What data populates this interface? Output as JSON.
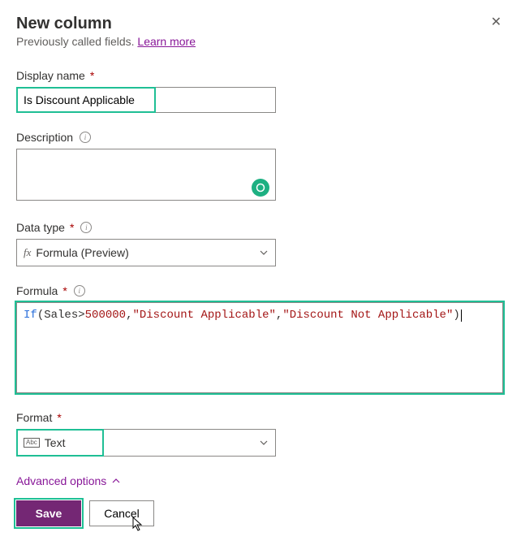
{
  "header": {
    "title": "New column",
    "subtitle_prefix": "Previously called fields. ",
    "learn_more": "Learn more"
  },
  "fields": {
    "display_name": {
      "label": "Display name",
      "value": "Is Discount Applicable"
    },
    "description": {
      "label": "Description",
      "value": ""
    },
    "data_type": {
      "label": "Data type",
      "selected": "Formula (Preview)"
    },
    "formula": {
      "label": "Formula",
      "tokens": {
        "fn": "If",
        "id": "Sales",
        "op_gt": ">",
        "num": "500000",
        "str1": "\"Discount Applicable\"",
        "str2": "\"Discount Not Applicable\""
      }
    },
    "format": {
      "label": "Format",
      "selected": "Text"
    }
  },
  "advanced": {
    "label": "Advanced options"
  },
  "buttons": {
    "save": "Save",
    "cancel": "Cancel"
  }
}
